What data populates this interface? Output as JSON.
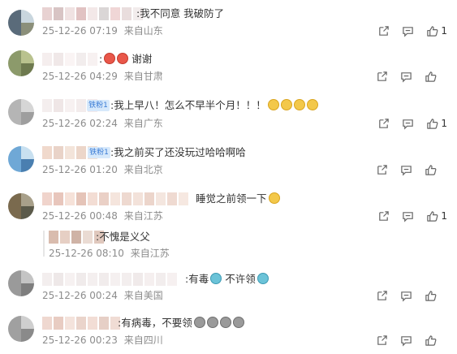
{
  "comments": [
    {
      "text": ":我不同意 我破防了",
      "date": "25-12-26 07:19",
      "location": "来自山东",
      "likes": "1",
      "avatar_colors": [
        "#5a6b7a",
        "#c9d6de",
        "#8b8f7a"
      ],
      "nick_colors": [
        "#e8d2d2",
        "#d8c4c4",
        "#f0e2e2",
        "#e1c2c2",
        "#f3e8e8",
        "#dad6d6",
        "#f0d6d6",
        "#e9dddd",
        "#f2ecec"
      ]
    },
    {
      "text": ":",
      "text2": "谢谢",
      "emoji": [
        "e-red",
        "e-red"
      ],
      "date": "25-12-26 04:29",
      "location": "来自甘肃",
      "likes": "",
      "avatar_colors": [
        "#8c9a6b",
        "#b9c28e",
        "#6e7a4f"
      ],
      "nick_colors": [
        "#f5eeee",
        "#f0e8e8",
        "#faf4f4",
        "#f2eded",
        "#f7f1f1"
      ]
    },
    {
      "badge": "铁粉1",
      "text": ":我上早八！怎么不早半个月！！！",
      "emoji": [
        "e-yellow",
        "e-yellow",
        "e-yellow",
        "e-yellow"
      ],
      "date": "25-12-26 02:24",
      "location": "来自广东",
      "likes": "1",
      "avatar_colors": [
        "#b5b5b5",
        "#d6d6d6",
        "#9e9e9e"
      ],
      "nick_colors": [
        "#f4eeee",
        "#efe6e6",
        "#f7f1f1",
        "#f3ecec",
        "#f5eaea"
      ]
    },
    {
      "badge": "铁粉1",
      "text": ":我之前买了还没玩过哈哈啊哈",
      "date": "25-12-26 01:20",
      "location": "来自北京",
      "likes": "",
      "avatar_colors": [
        "#6fa8d6",
        "#c8e0f0",
        "#4a7fb0"
      ],
      "nick_colors": [
        "#f0d9cc",
        "#e9d3c8",
        "#f3e4da",
        "#ecd6c9",
        "#f2e0d4"
      ]
    },
    {
      "text": "睡觉之前领一下",
      "emoji": [
        "e-yellow"
      ],
      "date": "25-12-26 00:48",
      "location": "来自江苏",
      "likes": "1",
      "avatar_colors": [
        "#7a6a4e",
        "#a8a08a",
        "#5b5a4a"
      ],
      "nick_colors": [
        "#f0d4cc",
        "#e8c6bc",
        "#f6e2d9",
        "#e5c4b8",
        "#f3ddd4",
        "#ead0c6",
        "#f5e5dd",
        "#eed9d0"
      ]
    },
    {
      "reply": true,
      "text": ":不愧是义父",
      "date": "25-12-26 08:10",
      "location": "来自江苏",
      "nick_colors": [
        "#d9bcae",
        "#e6cfc4",
        "#cfb3a6",
        "#eadbd3",
        "#e0c8bd"
      ]
    },
    {
      "text": ":有毒",
      "text2": "不许领",
      "emoji": [
        "e-teal"
      ],
      "emoji2": [
        "e-teal"
      ],
      "date": "25-12-26 00:24",
      "location": "来自美国",
      "likes": "",
      "avatar_colors": [
        "#9a9a9a",
        "#c4c4c4",
        "#7e7e7e"
      ],
      "nick_colors": [
        "#f3eeee",
        "#eee8e8",
        "#f6f1f1",
        "#f0ebeb",
        "#f4efef",
        "#f1ecec",
        "#f5f0f0"
      ]
    },
    {
      "text": ":有病毒，不要领",
      "emoji": [
        "e-gray",
        "e-gray",
        "e-gray",
        "e-gray"
      ],
      "date": "25-12-26 00:23",
      "location": "来自四川",
      "likes": "",
      "avatar_colors": [
        "#a0a0a0",
        "#cfcfcf",
        "#8a8a8a"
      ],
      "nick_colors": [
        "#efd8d0",
        "#e8ccc2",
        "#f4e3dc",
        "#ead4cb",
        "#f2ddd5",
        "#e6cfc6"
      ]
    }
  ],
  "icons": {
    "share": "share-icon",
    "comment": "comment-icon",
    "like": "like-icon"
  }
}
